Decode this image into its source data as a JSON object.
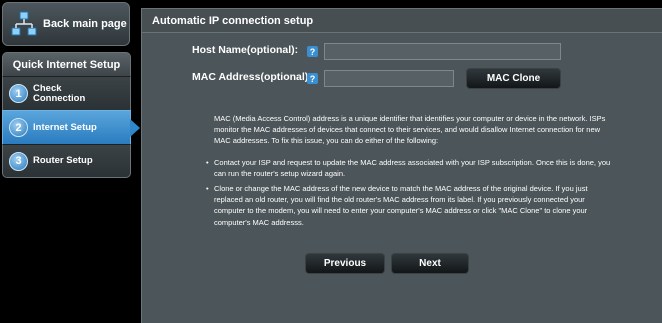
{
  "back": {
    "label": "Back main page",
    "icon": "network-topology-icon"
  },
  "steps": {
    "header": "Quick Internet Setup",
    "items": [
      {
        "num": "1",
        "label_line1": "Check",
        "label_line2": "Connection"
      },
      {
        "num": "2",
        "label": "Internet Setup"
      },
      {
        "num": "3",
        "label": "Router Setup"
      }
    ]
  },
  "panel": {
    "title": "Automatic IP connection setup",
    "host_label": "Host Name(optional):",
    "host_value": "",
    "mac_label": "MAC Address(optional)",
    "mac_value": "",
    "help": "?",
    "mac_clone": "MAC Clone",
    "intro": "MAC (Media Access Control) address is a unique identifier that identifies your computer or device in the network. ISPs monitor the MAC addresses of devices that connect to their services, and would disallow Internet connection for new MAC addresses. To fix this issue, you can do either of the following:",
    "bullet1": "Contact your ISP and request to update the MAC address associated with your ISP subscription. Once this is done, you can run the router's setup wizard again.",
    "bullet2": "Clone or change the MAC address of the new device to match the MAC address of the original device. If you just replaced an old router, you will find the old router's MAC address from its label. If you previously connected your computer to the modem, you will need to enter your computer's MAC address or click \"MAC Clone\" to clone your computer's MAC addresss.",
    "previous": "Previous",
    "next": "Next"
  },
  "colors": {
    "accent": "#2f86c8",
    "panel": "#4c5559"
  }
}
